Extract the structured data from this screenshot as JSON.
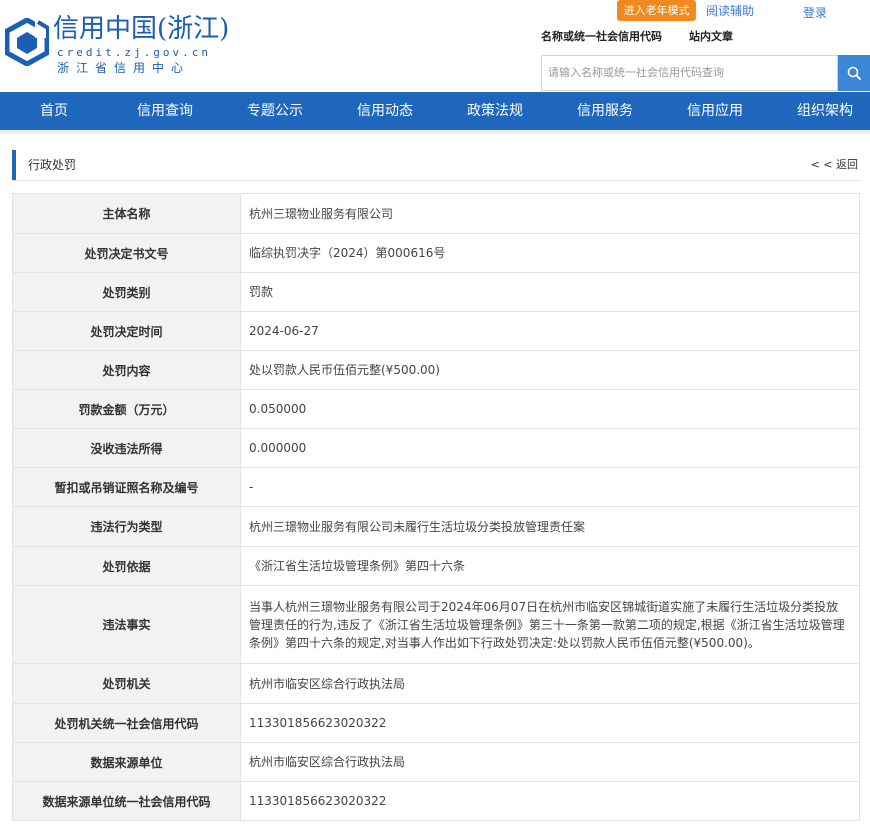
{
  "header": {
    "logo_title": "信用中国(浙江)",
    "logo_url": "credit.zj.gov.cn",
    "logo_subtitle": "浙江省信用中心",
    "elder_mode": "进入老年模式",
    "read_assist": "阅读辅助",
    "login": "登录",
    "search_tabs": [
      "名称或统一社会信用代码",
      "站内文章"
    ],
    "search_placeholder": "请输入名称或统一社会信用代码查询",
    "search_icon": "search-icon"
  },
  "nav": {
    "items": [
      "首页",
      "信用查询",
      "专题公示",
      "信用动态",
      "政策法规",
      "信用服务",
      "信用应用",
      "组织架构"
    ]
  },
  "section": {
    "title": "行政处罚",
    "back": "< < 返回"
  },
  "record": {
    "rows": [
      {
        "label": "主体名称",
        "value": "杭州三璟物业服务有限公司"
      },
      {
        "label": "处罚决定书文号",
        "value": "临综执罚决字（2024）第000616号"
      },
      {
        "label": "处罚类别",
        "value": "罚款"
      },
      {
        "label": "处罚决定时间",
        "value": "2024-06-27"
      },
      {
        "label": "处罚内容",
        "value": "处以罚款人民币伍佰元整(¥500.00)"
      },
      {
        "label": "罚款金额（万元）",
        "value": "0.050000"
      },
      {
        "label": "没收违法所得",
        "value": "0.000000"
      },
      {
        "label": "暂扣或吊销证照名称及编号",
        "value": "-"
      },
      {
        "label": "违法行为类型",
        "value": "杭州三璟物业服务有限公司未履行生活垃圾分类投放管理责任案"
      },
      {
        "label": "处罚依据",
        "value": "《浙江省生活垃圾管理条例》第四十六条"
      },
      {
        "label": "违法事实",
        "value": "当事人杭州三璟物业服务有限公司于2024年06月07日在杭州市临安区锦城街道实施了未履行生活垃圾分类投放管理责任的行为,违反了《浙江省生活垃圾管理条例》第三十一条第一款第二项的规定,根据《浙江省生活垃圾管理条例》第四十六条的规定,对当事人作出如下行政处罚决定:处以罚款人民币伍佰元整(¥500.00)。"
      },
      {
        "label": "处罚机关",
        "value": "杭州市临安区综合行政执法局"
      },
      {
        "label": "处罚机关统一社会信用代码",
        "value": "113301856623020322"
      },
      {
        "label": "数据来源单位",
        "value": "杭州市临安区综合行政执法局"
      },
      {
        "label": "数据来源单位统一社会信用代码",
        "value": "113301856623020322"
      }
    ]
  },
  "colors": {
    "nav_blue": "#1f66bd",
    "elder_orange": "#f08a1f",
    "label_bg": "#f2f2f2"
  }
}
